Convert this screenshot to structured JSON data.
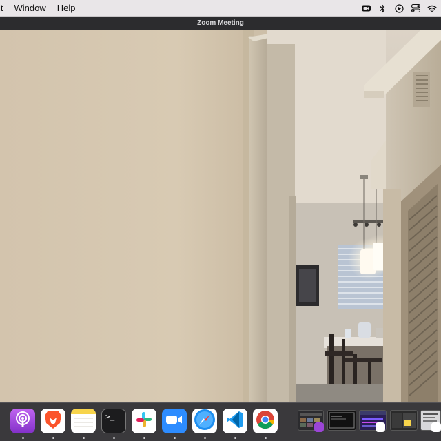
{
  "menubar": {
    "items": [
      "it",
      "Window",
      "Help"
    ],
    "status_icons": [
      "zoom-camera-icon",
      "bluetooth-icon",
      "play-icon",
      "control-center-icon",
      "wifi-icon"
    ]
  },
  "window": {
    "title": "Zoom Meeting"
  },
  "video": {
    "description_icon": "camera-feed"
  },
  "dock": {
    "apps": [
      {
        "name": "podcasts-app",
        "icon": "podcasts-icon",
        "color": "#9b45d6"
      },
      {
        "name": "brave-app",
        "icon": "brave-lion-icon",
        "color": "#ffffff"
      },
      {
        "name": "notes-app",
        "icon": "notes-icon",
        "color": "#f7d44b"
      },
      {
        "name": "terminal-app",
        "icon": "terminal-icon",
        "color": "#1e1e1e"
      },
      {
        "name": "slack-app",
        "icon": "slack-icon",
        "color": "#ffffff"
      },
      {
        "name": "zoom-app",
        "icon": "zoom-camera-icon",
        "color": "#2d8cff"
      },
      {
        "name": "safari-app",
        "icon": "safari-compass-icon",
        "color": "#ffffff"
      },
      {
        "name": "vscode-app",
        "icon": "vscode-icon",
        "color": "#ffffff"
      },
      {
        "name": "chrome-app",
        "icon": "chrome-icon",
        "color": "#ffffff"
      }
    ],
    "terminal_prompt": ">_"
  }
}
